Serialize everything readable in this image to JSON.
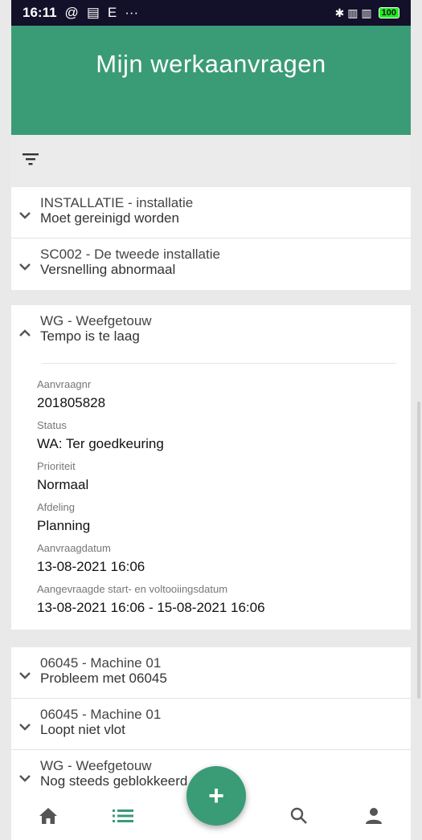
{
  "status_bar": {
    "time": "16:11",
    "left_icons": [
      "@",
      "▤",
      "E",
      "···"
    ],
    "right_icons": "✱ ▥ ▥",
    "battery": "100"
  },
  "header": {
    "title": "Mijn werkaanvragen"
  },
  "requests": [
    {
      "line1": "INSTALLATIE - installatie",
      "line2": "Moet gereinigd worden"
    },
    {
      "line1": "SC002 - De tweede installatie",
      "line2": "Versnelling abnormaal"
    }
  ],
  "expanded": {
    "line1": "WG - Weefgetouw",
    "line2": "Tempo is te laag",
    "fields": [
      {
        "label": "Aanvraagnr",
        "value": "201805828"
      },
      {
        "label": "Status",
        "value": "WA: Ter goedkeuring"
      },
      {
        "label": "Prioriteit",
        "value": "Normaal"
      },
      {
        "label": "Afdeling",
        "value": "Planning"
      },
      {
        "label": "Aanvraagdatum",
        "value": "13-08-2021 16:06"
      },
      {
        "label": "Aangevraagde start- en voltooiingsdatum",
        "value": "13-08-2021 16:06 - 15-08-2021 16:06"
      }
    ]
  },
  "requests_bottom": [
    {
      "line1": "06045 - Machine 01",
      "line2": "Probleem met 06045"
    },
    {
      "line1": "06045 - Machine 01",
      "line2": "Loopt niet vlot"
    },
    {
      "line1": "WG - Weefgetouw",
      "line2": "Nog steeds geblokkeerd"
    }
  ],
  "fab": {
    "label": "+"
  },
  "colors": {
    "primary": "#3a9b77",
    "statusbar": "#13102a"
  }
}
